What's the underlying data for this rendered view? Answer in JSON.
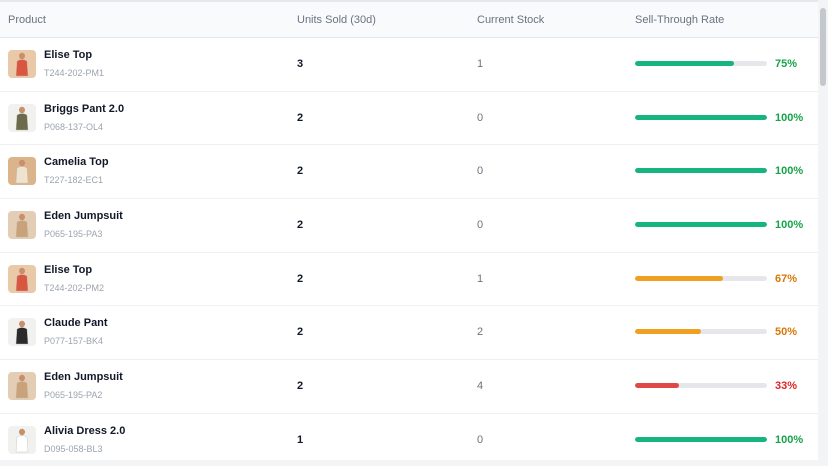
{
  "table": {
    "headers": {
      "product": "Product",
      "units_sold": "Units Sold (30d)",
      "current_stock": "Current Stock",
      "sell_through": "Sell-Through Rate"
    },
    "rows": [
      {
        "name": "Elise Top",
        "sku": "T244-202-PM1",
        "units": "3",
        "stock": "1",
        "rate": 75,
        "rate_label": "75%",
        "status": "good",
        "thumb_color": "#d9573f",
        "thumb_bg": "#e9c9a8"
      },
      {
        "name": "Briggs Pant 2.0",
        "sku": "P068-137-OL4",
        "units": "2",
        "stock": "0",
        "rate": 100,
        "rate_label": "100%",
        "status": "good",
        "thumb_color": "#6b6a4a",
        "thumb_bg": "#f1f1ef"
      },
      {
        "name": "Camelia Top",
        "sku": "T227-182-EC1",
        "units": "2",
        "stock": "0",
        "rate": 100,
        "rate_label": "100%",
        "status": "good",
        "thumb_color": "#efe3cf",
        "thumb_bg": "#dcb48c"
      },
      {
        "name": "Eden Jumpsuit",
        "sku": "P065-195-PA3",
        "units": "2",
        "stock": "0",
        "rate": 100,
        "rate_label": "100%",
        "status": "good",
        "thumb_color": "#c9a27a",
        "thumb_bg": "#e3cdb4"
      },
      {
        "name": "Elise Top",
        "sku": "T244-202-PM2",
        "units": "2",
        "stock": "1",
        "rate": 67,
        "rate_label": "67%",
        "status": "warn",
        "thumb_color": "#d9573f",
        "thumb_bg": "#e9c9a8"
      },
      {
        "name": "Claude Pant",
        "sku": "P077-157-BK4",
        "units": "2",
        "stock": "2",
        "rate": 50,
        "rate_label": "50%",
        "status": "warn",
        "thumb_color": "#2b2b2b",
        "thumb_bg": "#f1f1ef"
      },
      {
        "name": "Eden Jumpsuit",
        "sku": "P065-195-PA2",
        "units": "2",
        "stock": "4",
        "rate": 33,
        "rate_label": "33%",
        "status": "bad",
        "thumb_color": "#c9a27a",
        "thumb_bg": "#e3cdb4"
      },
      {
        "name": "Alivia Dress 2.0",
        "sku": "D095-058-BL3",
        "units": "1",
        "stock": "0",
        "rate": 100,
        "rate_label": "100%",
        "status": "good",
        "thumb_color": "#ffffff",
        "thumb_bg": "#f1f1ef"
      }
    ]
  },
  "colors": {
    "good": "#16b47e",
    "good_text": "#16a34a",
    "warn": "#f0a020",
    "warn_text": "#d97706",
    "bad": "#e04848",
    "bad_text": "#dc2626"
  }
}
